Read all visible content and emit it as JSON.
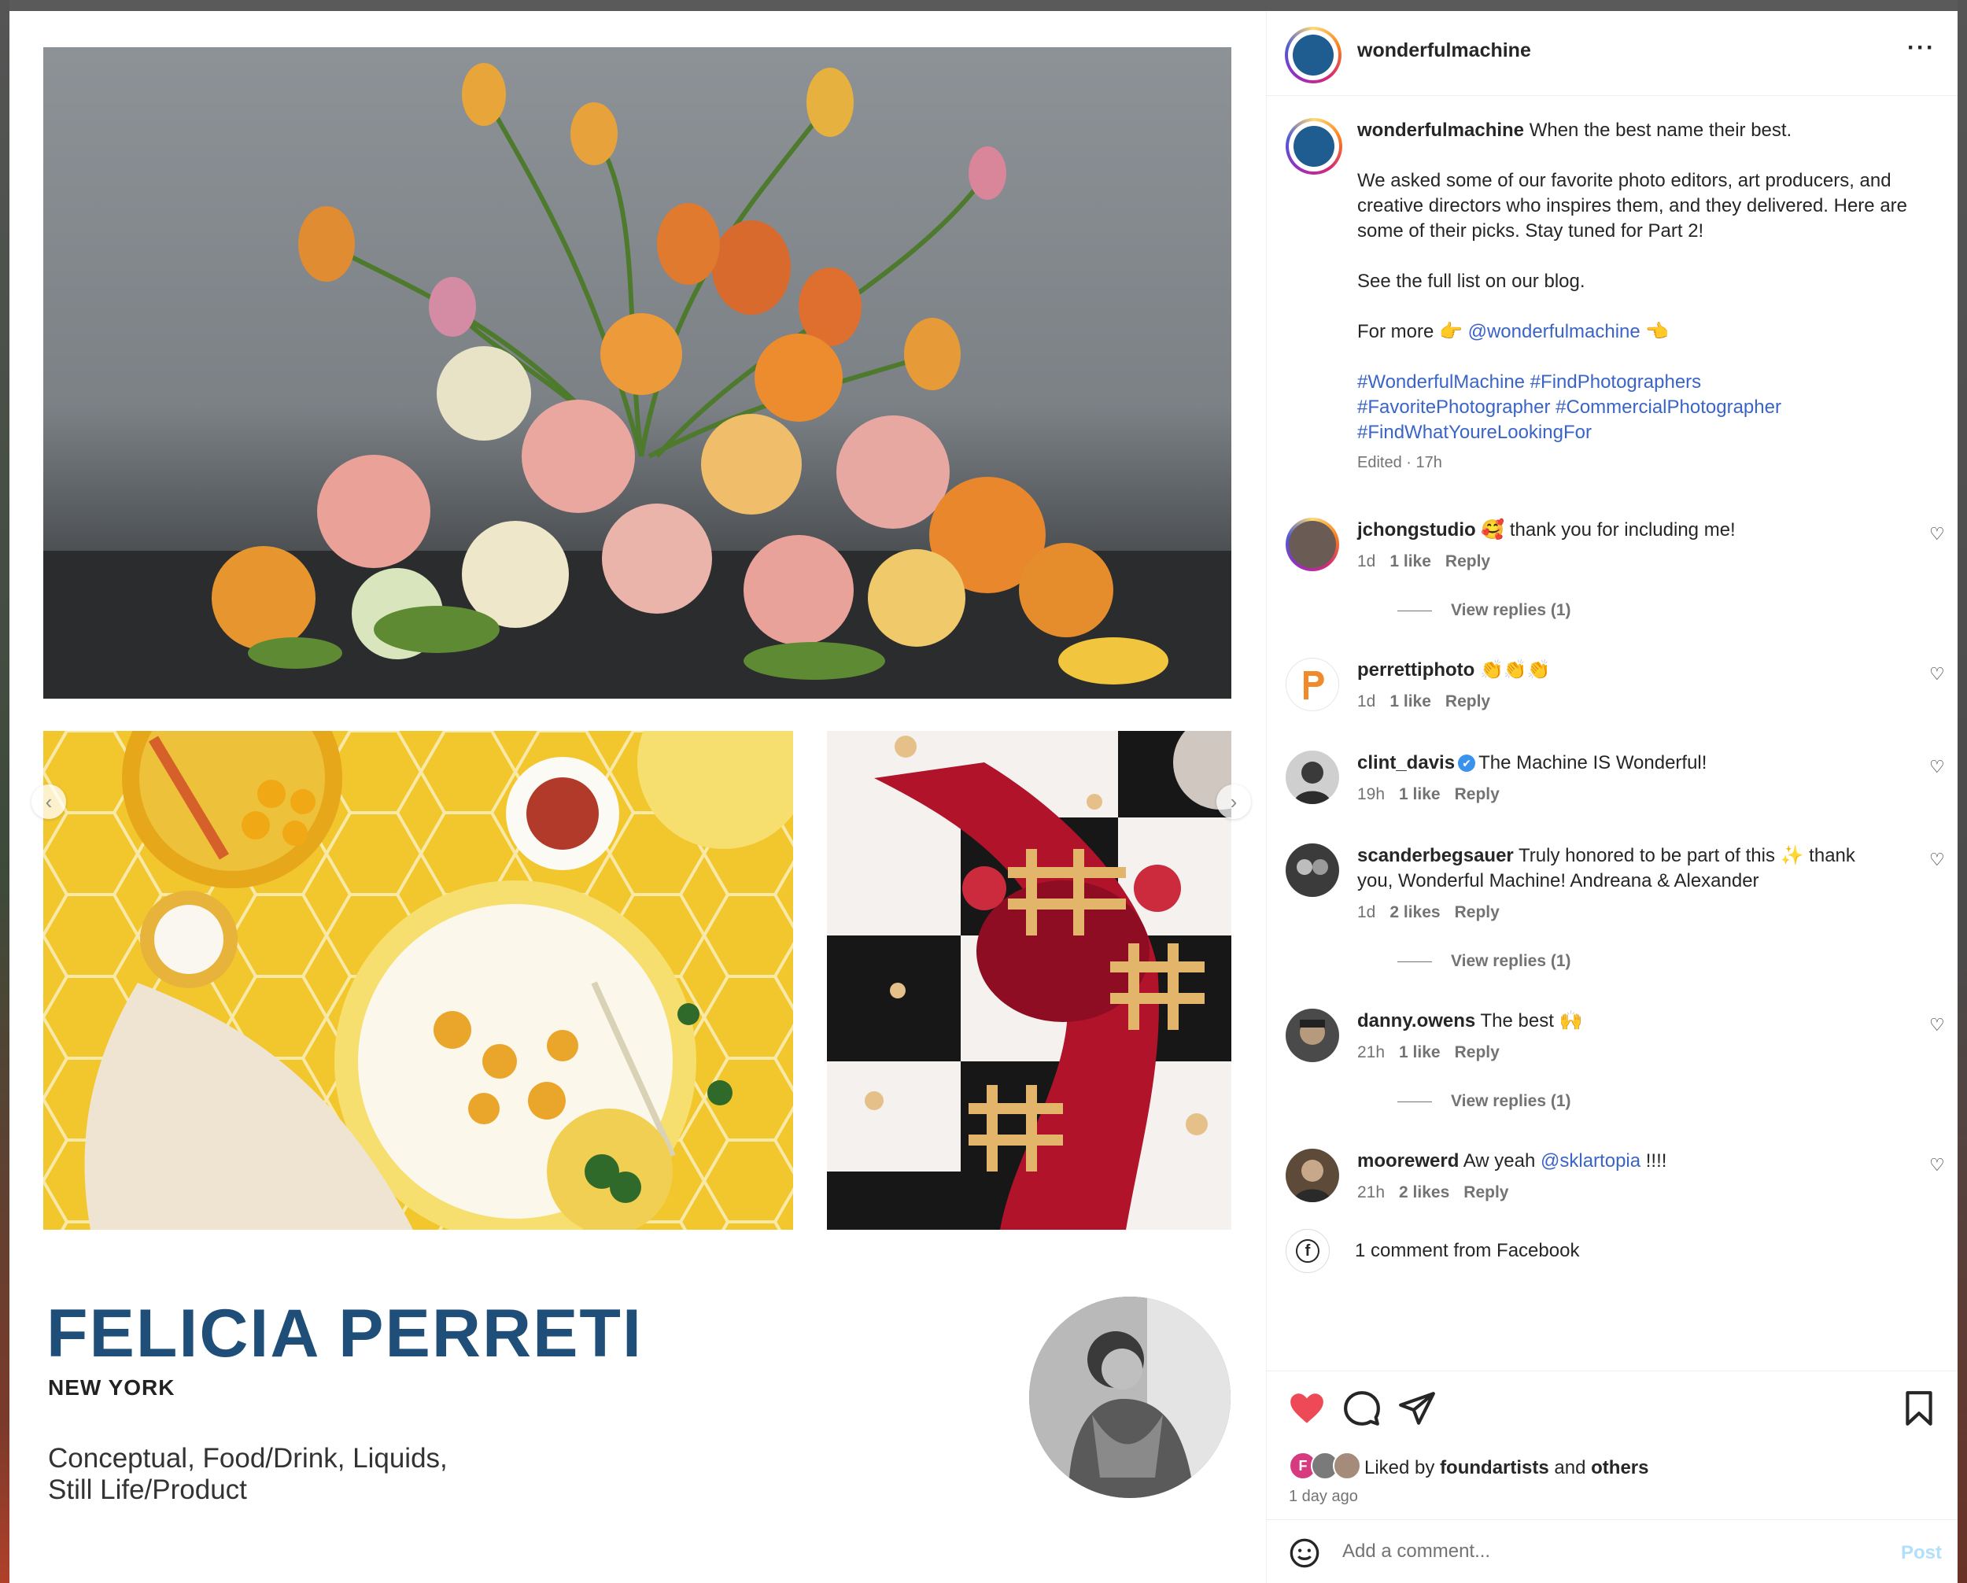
{
  "account": {
    "username": "wonderfulmachine",
    "more_icon": "more-horizontal-icon"
  },
  "media": {
    "feature_name": "FELICIA PERRETI",
    "feature_city": "NEW YORK",
    "feature_desc_line1": "Conceptual, Food/Drink, Liquids,",
    "feature_desc_line2": "Still Life/Product",
    "prev_arrow": "‹",
    "next_arrow": "›"
  },
  "caption": {
    "username": "wonderfulmachine",
    "line1": "When the best name their best.",
    "paragraph2": "We asked some of our favorite photo editors, art producers, and creative directors who inspires them, and they delivered. Here are some of their picks. Stay tuned for Part 2!",
    "paragraph3": "See the full list on our blog.",
    "for_more_label": "For more",
    "for_more_emoji_left": "👉",
    "mention": "@wonderfulmachine",
    "for_more_emoji_right": "👈",
    "hashtags_line1": "#WonderfulMachine #FindPhotographers",
    "hashtags_line2": "#FavoritePhotographer #CommercialPhotographer",
    "hashtags_line3": "#FindWhatYoureLookingFor",
    "meta": "Edited · 17h"
  },
  "comments": [
    {
      "username": "jchongstudio",
      "text": "🥰 thank you for including me!",
      "time": "1d",
      "likes": "1 like",
      "reply": "Reply",
      "view_replies": "View replies (1)"
    },
    {
      "username": "perrettiphoto",
      "text": "👏👏👏",
      "time": "1d",
      "likes": "1 like",
      "reply": "Reply"
    },
    {
      "username": "clint_davis",
      "verified": "✔",
      "text": "The Machine IS Wonderful!",
      "time": "19h",
      "likes": "1 like",
      "reply": "Reply"
    },
    {
      "username": "scanderbegsauer",
      "text": "Truly honored to be part of this ✨ thank you, Wonderful Machine! Andreana & Alexander",
      "time": "1d",
      "likes": "2 likes",
      "reply": "Reply",
      "view_replies": "View replies (1)"
    },
    {
      "username": "danny.owens",
      "text": "The best 🙌",
      "time": "21h",
      "likes": "1 like",
      "reply": "Reply",
      "view_replies": "View replies (1)"
    },
    {
      "username": "moorewerd",
      "text_before": "Aw yeah",
      "mention": "@sklartopia",
      "text_after": "!!!!",
      "time": "21h",
      "likes": "2 likes",
      "reply": "Reply"
    }
  ],
  "facebook": {
    "icon_letter": "f",
    "text": "1 comment from Facebook"
  },
  "likes": {
    "prefix": "Liked by",
    "user": "foundartists",
    "connector": "and",
    "others": "others",
    "time_ago": "1 day ago",
    "first_avatar_letter": "F"
  },
  "composer": {
    "placeholder": "Add a comment...",
    "post_label": "Post"
  },
  "colors": {
    "heart": "#ed4956",
    "link": "#3a64c8",
    "feature_name": "#1f4f78",
    "post_disabled": "#b2dffc"
  },
  "icons": [
    "heart-icon",
    "comment-icon",
    "share-icon",
    "bookmark-icon",
    "emoji-icon",
    "facebook-icon",
    "heart-outline-icon"
  ]
}
